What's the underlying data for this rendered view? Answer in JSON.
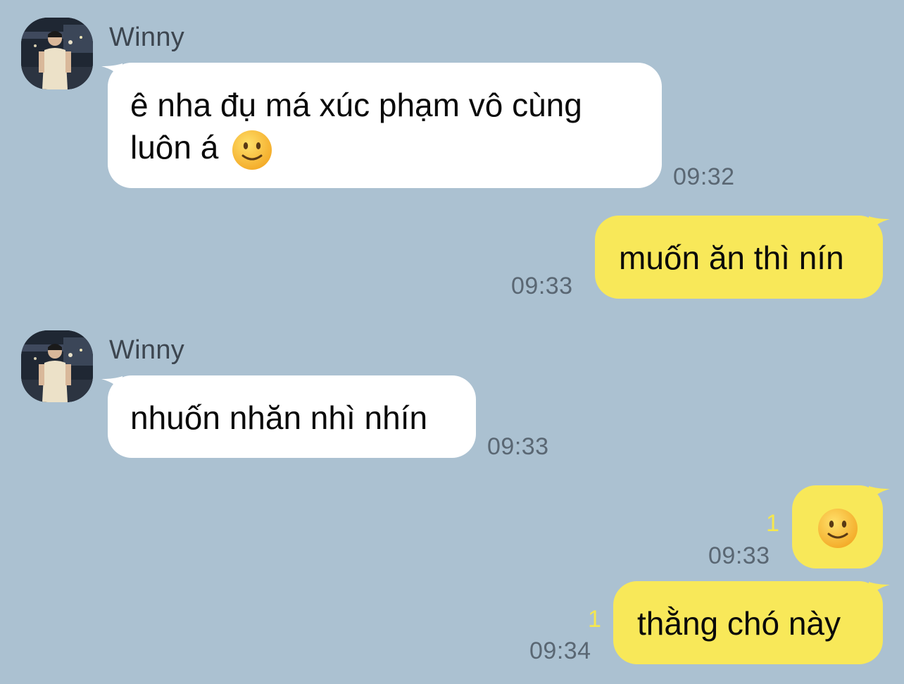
{
  "messages": [
    {
      "sender": "Winny",
      "text": "ê nha đụ má xúc phạm vô cùng",
      "text2": "luôn á",
      "emoji": "slightly-smiling-face",
      "time": "09:32"
    },
    {
      "text": "muốn ăn thì nín",
      "time": "09:33"
    },
    {
      "sender": "Winny",
      "text": "nhuốn nhăn nhì nhín",
      "time": "09:33"
    },
    {
      "emoji": "slightly-smiling-face",
      "unread": "1",
      "time": "09:33"
    },
    {
      "text": "thằng chó này",
      "unread": "1",
      "time": "09:34"
    }
  ],
  "colors": {
    "background": "#abc1d1",
    "incoming_bubble": "#ffffff",
    "outgoing_bubble": "#f8e859",
    "unread_count": "#f5e74e"
  }
}
